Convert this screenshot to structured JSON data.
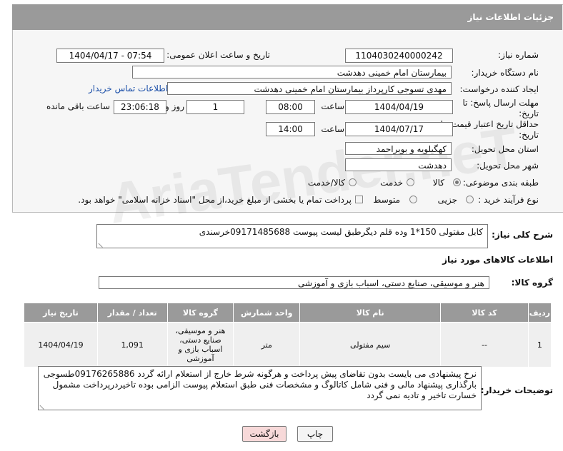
{
  "header": {
    "title": "جزئیات اطلاعات نیاز"
  },
  "fields": {
    "need_number_label": "شماره نیاز:",
    "need_number": "1104030240000242",
    "announce_label": "تاریخ و ساعت اعلان عمومی:",
    "announce_value": "1404/04/17 - 07:54",
    "buyer_org_label": "نام دستگاه خریدار:",
    "buyer_org": "بیمارستان امام خمینی دهدشت",
    "requester_label": "ایجاد کننده درخواست:",
    "requester": "مهدی تسوجی کارپرداز بیمارستان امام خمینی دهدشت",
    "buyer_contact_link": "اطلاعات تماس خریدار",
    "deadline_label": "مهلت ارسال پاسخ: تا تاریخ:",
    "deadline_date": "1404/04/19",
    "time_label": "ساعت",
    "deadline_time": "08:00",
    "days_value": "1",
    "days_label": "روز و",
    "remaining_time": "23:06:18",
    "remaining_label": "ساعت باقی مانده",
    "validity_label": "حداقل تاریخ اعتبار قیمت: تا تاریخ:",
    "validity_date": "1404/07/17",
    "validity_time": "14:00",
    "province_label": "استان محل تحویل:",
    "province": "کهگیلویه و بویراحمد",
    "city_label": "شهر محل تحویل:",
    "city": "دهدشت",
    "category_label": "طبقه بندی موضوعی:",
    "category_options": [
      "کالا",
      "خدمت",
      "کالا/خدمت"
    ],
    "purchase_type_label": "نوع فرآیند خرید :",
    "purchase_options": [
      "جزیی",
      "متوسط"
    ],
    "payment_note": "پرداخت تمام یا بخشی از مبلغ خرید،از محل \"اسناد خزانه اسلامی\" خواهد بود."
  },
  "summary": {
    "label": "شرح کلی نیاز:",
    "text": "کابل مفتولی 150*1 وده قلم دیگرطبق لیست پیوست 09171485688خرسندی"
  },
  "items_section": {
    "title": "اطلاعات کالاهای مورد نیاز",
    "group_label": "گروه کالا:",
    "group_value": "هنر و موسیقی، صنایع دستی، اسباب بازی و آموزشی"
  },
  "table": {
    "headers": [
      "ردیف",
      "کد کالا",
      "نام کالا",
      "واحد شمارش",
      "گروه کالا",
      "تعداد / مقدار",
      "تاریخ نیاز"
    ],
    "rows": [
      [
        "1",
        "--",
        "سیم مفتولی",
        "متر",
        "هنر و موسیقی، صنایع دستی، اسباب بازی و آموزشی",
        "1,091",
        "1404/04/19"
      ]
    ]
  },
  "buyer_notes": {
    "label": "توضیحات خریدار:",
    "text": "نرخ پیشنهادی می بایست بدون تقاضای پیش پرداخت و هرگونه شرط خارج از استعلام ارائه گردد 09176265886طسوجی بارگذاری پیشنهاد مالی و فنی شامل کاتالوگ و مشخصات فنی طبق استعلام پیوست الزامی بوده تاخیردرپرداخت مشمول خسارت تاخیر و تادیه نمی گردد"
  },
  "buttons": {
    "print": "چاپ",
    "back": "بازگشت"
  },
  "colors": {
    "header_bg": "#9a9a9a",
    "link": "#1a4ea8",
    "back_btn_bg": "#f7d9d9"
  }
}
